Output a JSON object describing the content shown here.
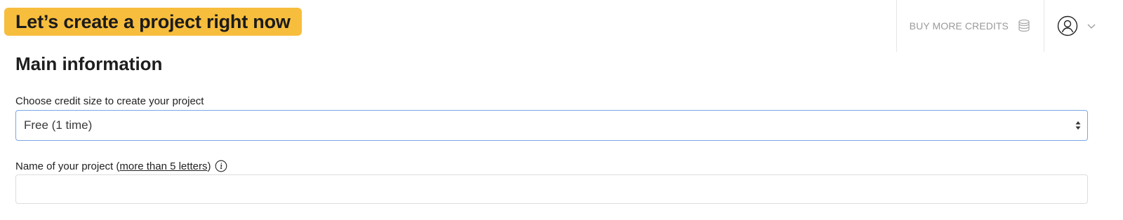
{
  "banner": {
    "text": "Let’s create a project right now"
  },
  "header": {
    "buy_credits_label": "BUY MORE CREDITS",
    "icons": {
      "credits": "coins-icon",
      "user": "user-avatar-icon",
      "menu": "chevron-down-icon"
    }
  },
  "main": {
    "section_title": "Main information",
    "credit_size": {
      "label": "Choose credit size to create your project",
      "selected_value": "Free (1 time)"
    },
    "project_name": {
      "label_prefix": "Name of your project (",
      "label_link": "more than 5 letters",
      "label_suffix": ")",
      "value": "",
      "placeholder": ""
    }
  },
  "colors": {
    "banner_bg": "#f7bd3d",
    "select_border": "#7aa6e8",
    "muted_text": "#9a9a9a"
  }
}
